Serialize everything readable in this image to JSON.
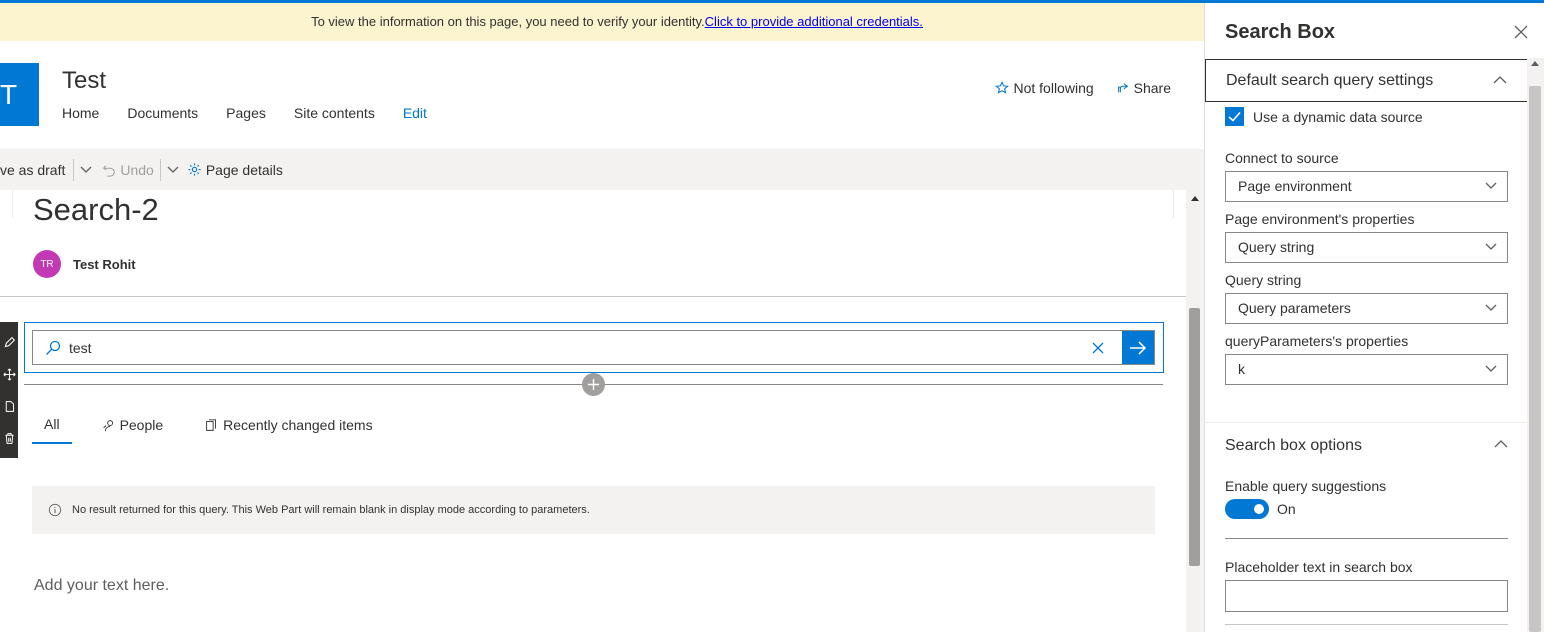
{
  "notice": {
    "text": "To view the information on this page, you need to verify your identity.",
    "link": "Click to provide additional credentials."
  },
  "site": {
    "logo_letter": "T",
    "title": "Test",
    "nav": [
      "Home",
      "Documents",
      "Pages",
      "Site contents",
      "Edit"
    ],
    "follow_label": "Not following",
    "share_label": "Share"
  },
  "commandbar": {
    "save_label": "ve as draft",
    "undo_label": "Undo",
    "page_details_label": "Page details"
  },
  "page": {
    "title": "Search-2",
    "author_initials": "TR",
    "author_name": "Test Rohit",
    "search_value": "test",
    "tabs": [
      "All",
      "People",
      "Recently changed items"
    ],
    "message": "No result returned for this query. This Web Part will remain blank in display mode according to parameters.",
    "add_text_placeholder": "Add your text here."
  },
  "panel": {
    "title": "Search Box",
    "group1_title": "Default search query settings",
    "dynamic_source_label": "Use a dynamic data source",
    "dynamic_source_checked": true,
    "connect_label": "Connect to source",
    "connect_value": "Page environment",
    "env_props_label": "Page environment's properties",
    "env_props_value": "Query string",
    "query_string_label": "Query string",
    "query_string_value": "Query parameters",
    "qp_props_label": "queryParameters's properties",
    "qp_props_value": "k",
    "group2_title": "Search box options",
    "suggestions_label": "Enable query suggestions",
    "suggestions_state": "On",
    "placeholder_label": "Placeholder text in search box",
    "placeholder_value": ""
  },
  "colors": {
    "accent": "#0078d4",
    "notice_bg": "#fcf3cf",
    "avatar": "#c239b3"
  }
}
